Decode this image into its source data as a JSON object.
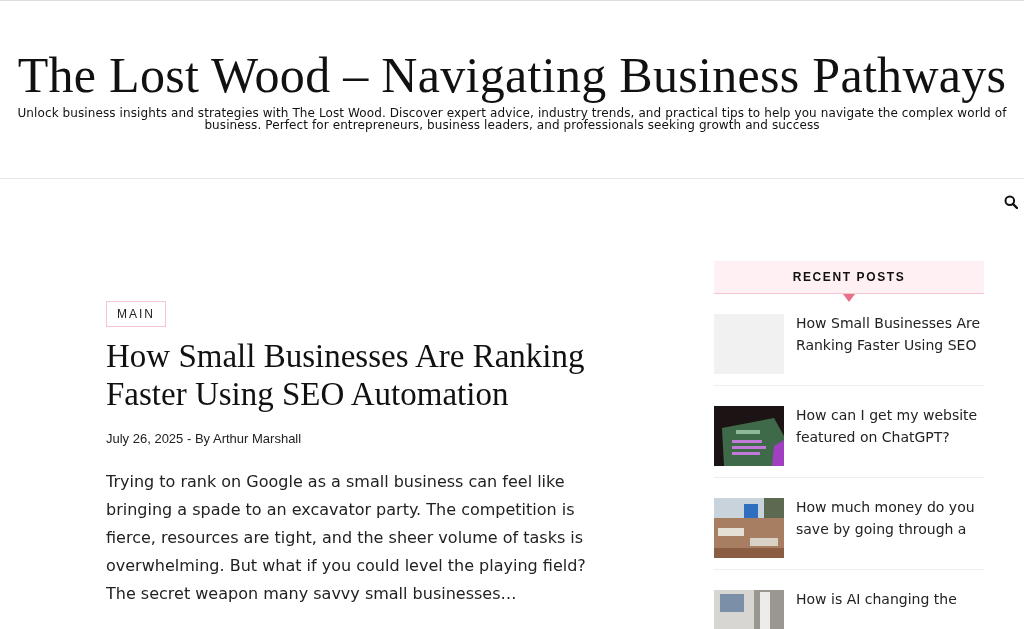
{
  "site": {
    "title": "The Lost Wood – Navigating Business Pathways",
    "tagline": "Unlock business insights and strategies with The Lost Wood. Discover expert advice, industry trends, and practical tips to help you navigate the complex world of business. Perfect for entrepreneurs, business leaders, and professionals seeking growth and success"
  },
  "post": {
    "category": "MAIN",
    "title": "How Small Businesses Are Ranking Faster Using SEO Automation",
    "date": "July 26, 2025",
    "by": "- By",
    "author": "Arthur Marshall",
    "excerpt": "Trying to rank on Google as a small business can feel like bringing a spade to an excavator party. The competition is fierce, resources are tight, and the sheer volume of tasks is overwhelming. But what if you could level the playing field? The secret weapon many savvy small businesses…"
  },
  "sidebar": {
    "heading": "RECENT POSTS",
    "posts": [
      {
        "title": "How Small Businesses Are Ranking Faster Using SEO",
        "kind": "placeholder"
      },
      {
        "title": "How can I get my website featured on ChatGPT?",
        "kind": "picture"
      },
      {
        "title": "How much money do you save by going through a",
        "kind": "picture"
      },
      {
        "title": "How is AI changing the",
        "kind": "picture"
      }
    ]
  }
}
